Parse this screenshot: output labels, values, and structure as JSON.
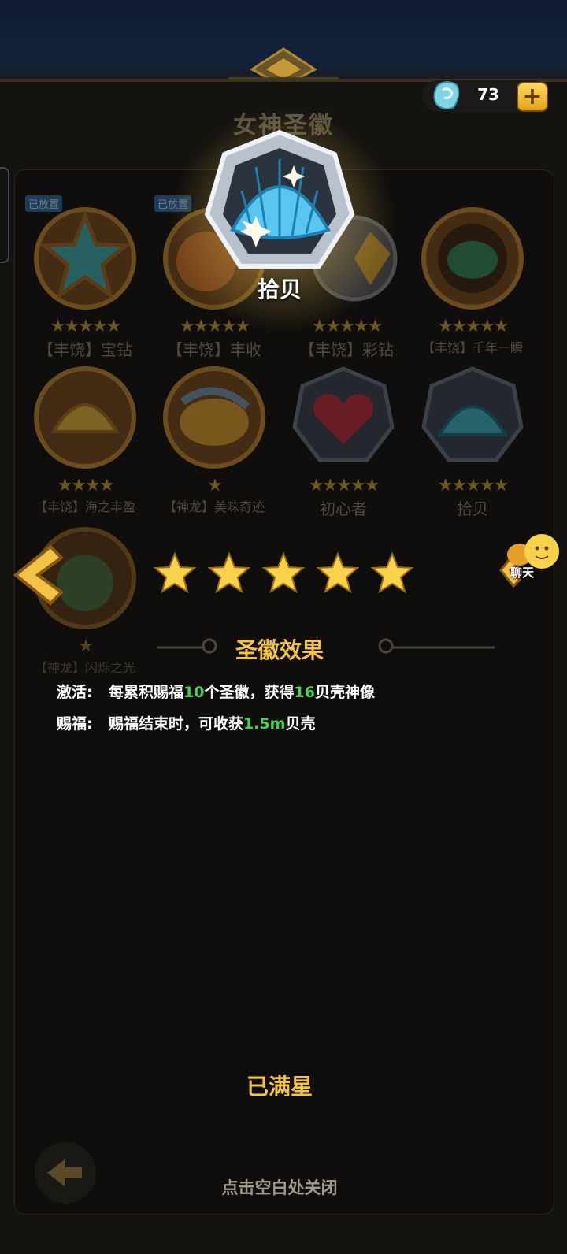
{
  "currency": {
    "icon": "shell-gem-icon",
    "value": "73",
    "add_label": "+"
  },
  "panel": {
    "title": "女神圣徽"
  },
  "featured": {
    "name": "拾贝",
    "icon": "scallop-shell-icon"
  },
  "grid": [
    {
      "name": "【丰饶】宝钻",
      "stars": "★★★★★",
      "badge": "已放置",
      "icon": "star-medal-icon"
    },
    {
      "name": "【丰饶】丰收",
      "stars": "★★★★★",
      "badge": "已放置",
      "icon": "harvest-medal-icon"
    },
    {
      "name": "【丰饶】彩钻",
      "stars": "★★★★★",
      "badge": "",
      "icon": "colored-diamond-medal-icon"
    },
    {
      "name": "【丰饶】千年一瞬",
      "stars": "★★★★★",
      "badge": "",
      "icon": "fish-medal-icon"
    },
    {
      "name": "【丰饶】海之丰盈",
      "stars": "★★★★",
      "badge": "",
      "icon": "golden-shell-medal-icon"
    },
    {
      "name": "【神龙】美味奇迹",
      "stars": "★",
      "badge": "",
      "icon": "dragon-feast-medal-icon"
    },
    {
      "name": "初心者",
      "stars": "★★★★★",
      "badge": "",
      "icon": "heart-medal-icon"
    },
    {
      "name": "拾贝",
      "stars": "★★★★★",
      "badge": "",
      "icon": "shell-medal-icon"
    },
    {
      "name": "【神龙】闪烁之光",
      "stars": "★",
      "badge": "",
      "icon": "dragon-light-medal-icon"
    }
  ],
  "rating": {
    "stars": 5,
    "max": 5
  },
  "effect": {
    "title": "圣徽效果",
    "activate_label": "激活:",
    "activate_pre": "每累积赐福",
    "activate_num1": "10",
    "activate_mid": "个圣徽，获得",
    "activate_num2": "16",
    "activate_post": "贝壳神像",
    "bless_label": "赐福:",
    "bless_pre": "赐福结束时，可收获",
    "bless_num": "1.5m",
    "bless_post": "贝壳"
  },
  "status": "已满星",
  "close_hint": "点击空白处关闭",
  "chat": {
    "label": "聊天"
  },
  "colors": {
    "gold": "#f2c347",
    "green": "#4bd152",
    "panel": "#0f0e0c"
  }
}
